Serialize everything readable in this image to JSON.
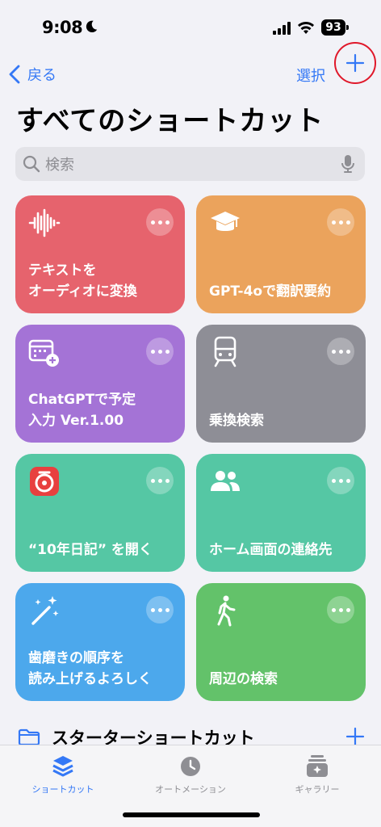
{
  "status": {
    "time": "9:08",
    "battery": "93"
  },
  "nav": {
    "back_label": "戻る",
    "select_label": "選択"
  },
  "page": {
    "title": "すべてのショートカット"
  },
  "search": {
    "placeholder": "検索"
  },
  "cards": [
    {
      "title": "テキストを\nオーディオに変換",
      "icon": "waveform-icon",
      "color": "#e6636d"
    },
    {
      "title": "GPT-4oで翻訳要約",
      "icon": "graduation-cap-icon",
      "color": "#eba35c"
    },
    {
      "title": "ChatGPTで予定\n入力 Ver.1.00",
      "icon": "calendar-add-icon",
      "color": "#a473d6"
    },
    {
      "title": "乗換検索",
      "icon": "train-icon",
      "color": "#8e8e96"
    },
    {
      "title": "“10年日記” を開く",
      "icon": "app-icon-red",
      "color": "#55c7a4"
    },
    {
      "title": "ホーム画面の連絡先",
      "icon": "people-icon",
      "color": "#55c7a4"
    },
    {
      "title": "歯磨きの順序を\n読み上げるよろしく",
      "icon": "magic-wand-icon",
      "color": "#4ca8ec"
    },
    {
      "title": "周辺の検索",
      "icon": "walking-icon",
      "color": "#63c26a"
    }
  ],
  "section": {
    "title": "スターターショートカット"
  },
  "tabs": [
    {
      "label": "ショートカット",
      "icon": "layers-icon",
      "active": true
    },
    {
      "label": "オートメーション",
      "icon": "clock-icon",
      "active": false
    },
    {
      "label": "ギャラリー",
      "icon": "gallery-icon",
      "active": false
    }
  ],
  "colors": {
    "accent": "#3478f6",
    "highlight_circle": "#e0182a"
  }
}
